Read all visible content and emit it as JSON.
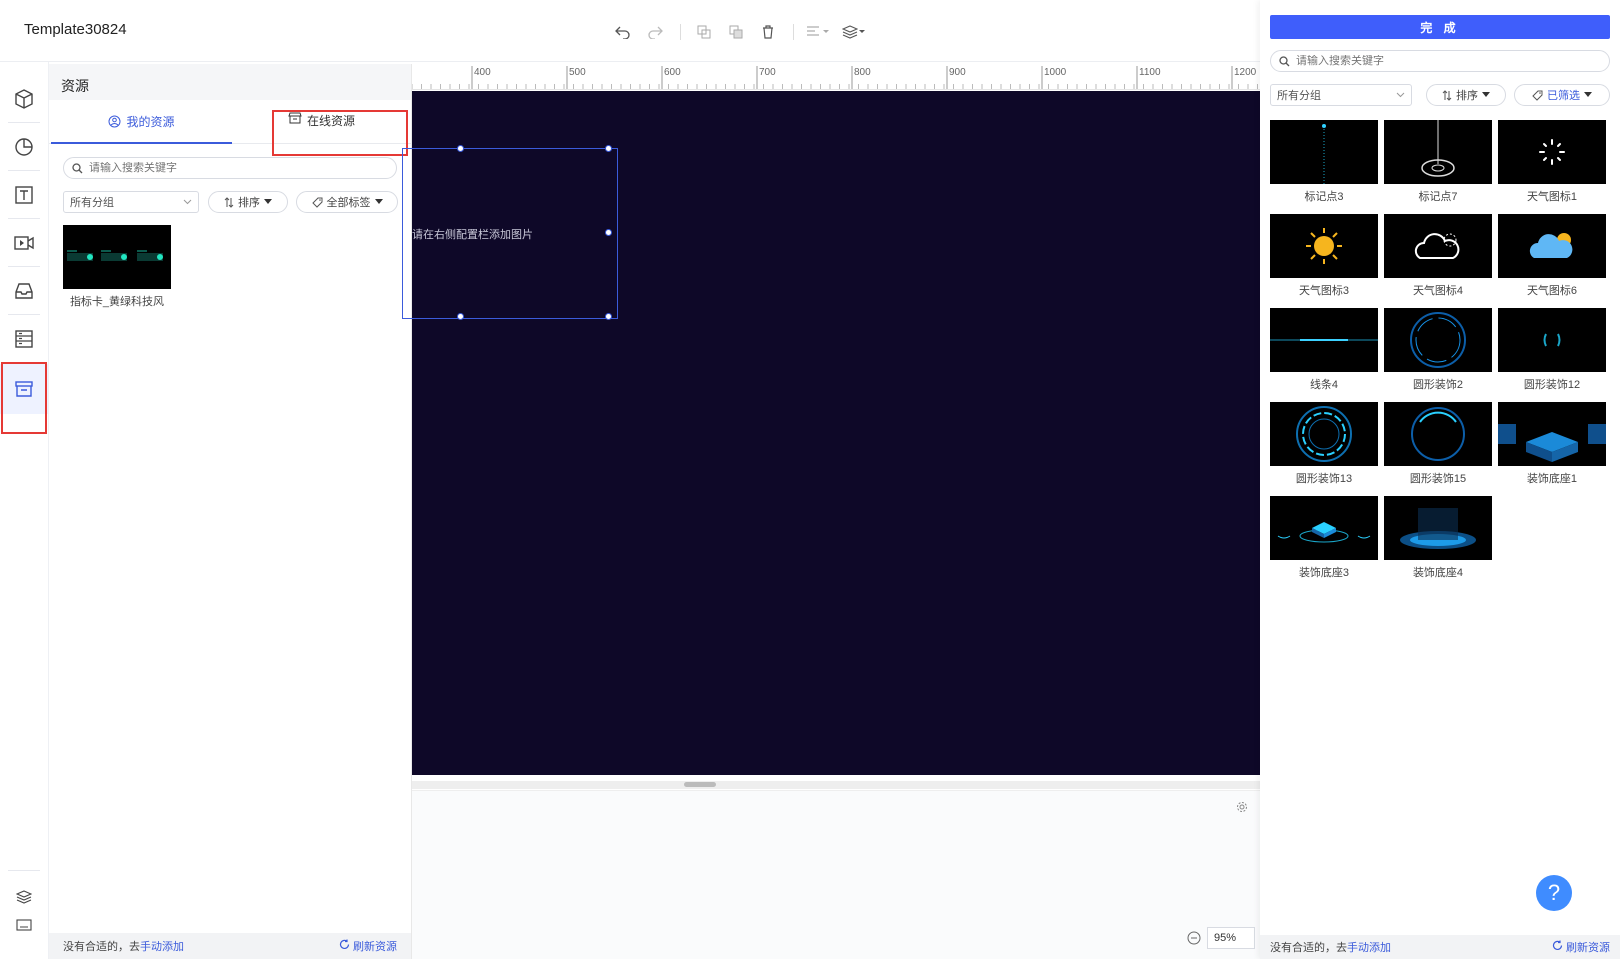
{
  "header": {
    "title": "Template30824"
  },
  "panel": {
    "title": "资源",
    "tabs": [
      {
        "label": "我的资源"
      },
      {
        "label": "在线资源"
      }
    ],
    "search_placeholder": "请输入搜索关键字",
    "group_select": "所有分组",
    "sort_label": "排序",
    "tags_label": "全部标签",
    "items": [
      {
        "label": "指标卡_黄绿科技风"
      }
    ],
    "footer": {
      "prefix": "没有合适的，去",
      "add_link": "手动添加",
      "refresh": "刷新资源"
    }
  },
  "canvas": {
    "ruler_ticks": [
      "400",
      "500",
      "600",
      "700",
      "800",
      "900",
      "1000",
      "1100",
      "1200"
    ],
    "placeholder": "请在右侧配置栏添加图片",
    "zoom": "95%"
  },
  "online": {
    "done_label": "完 成",
    "search_placeholder": "请输入搜索关键字",
    "group_select": "所有分组",
    "sort_label": "排序",
    "filter_label": "已筛选",
    "items": [
      {
        "label": "标记点3"
      },
      {
        "label": "标记点7"
      },
      {
        "label": "天气图标1"
      },
      {
        "label": "天气图标3"
      },
      {
        "label": "天气图标4"
      },
      {
        "label": "天气图标6"
      },
      {
        "label": "线条4"
      },
      {
        "label": "圆形装饰2"
      },
      {
        "label": "圆形装饰12"
      },
      {
        "label": "圆形装饰13"
      },
      {
        "label": "圆形装饰15"
      },
      {
        "label": "装饰底座1"
      },
      {
        "label": "装饰底座3"
      },
      {
        "label": "装饰底座4"
      }
    ],
    "footer": {
      "prefix": "没有合适的，去",
      "add_link": "手动添加",
      "refresh": "刷新资源"
    }
  },
  "colors": {
    "accent": "#3f5efb",
    "canvas_bg": "#0e0828",
    "highlight": "#e53935"
  }
}
